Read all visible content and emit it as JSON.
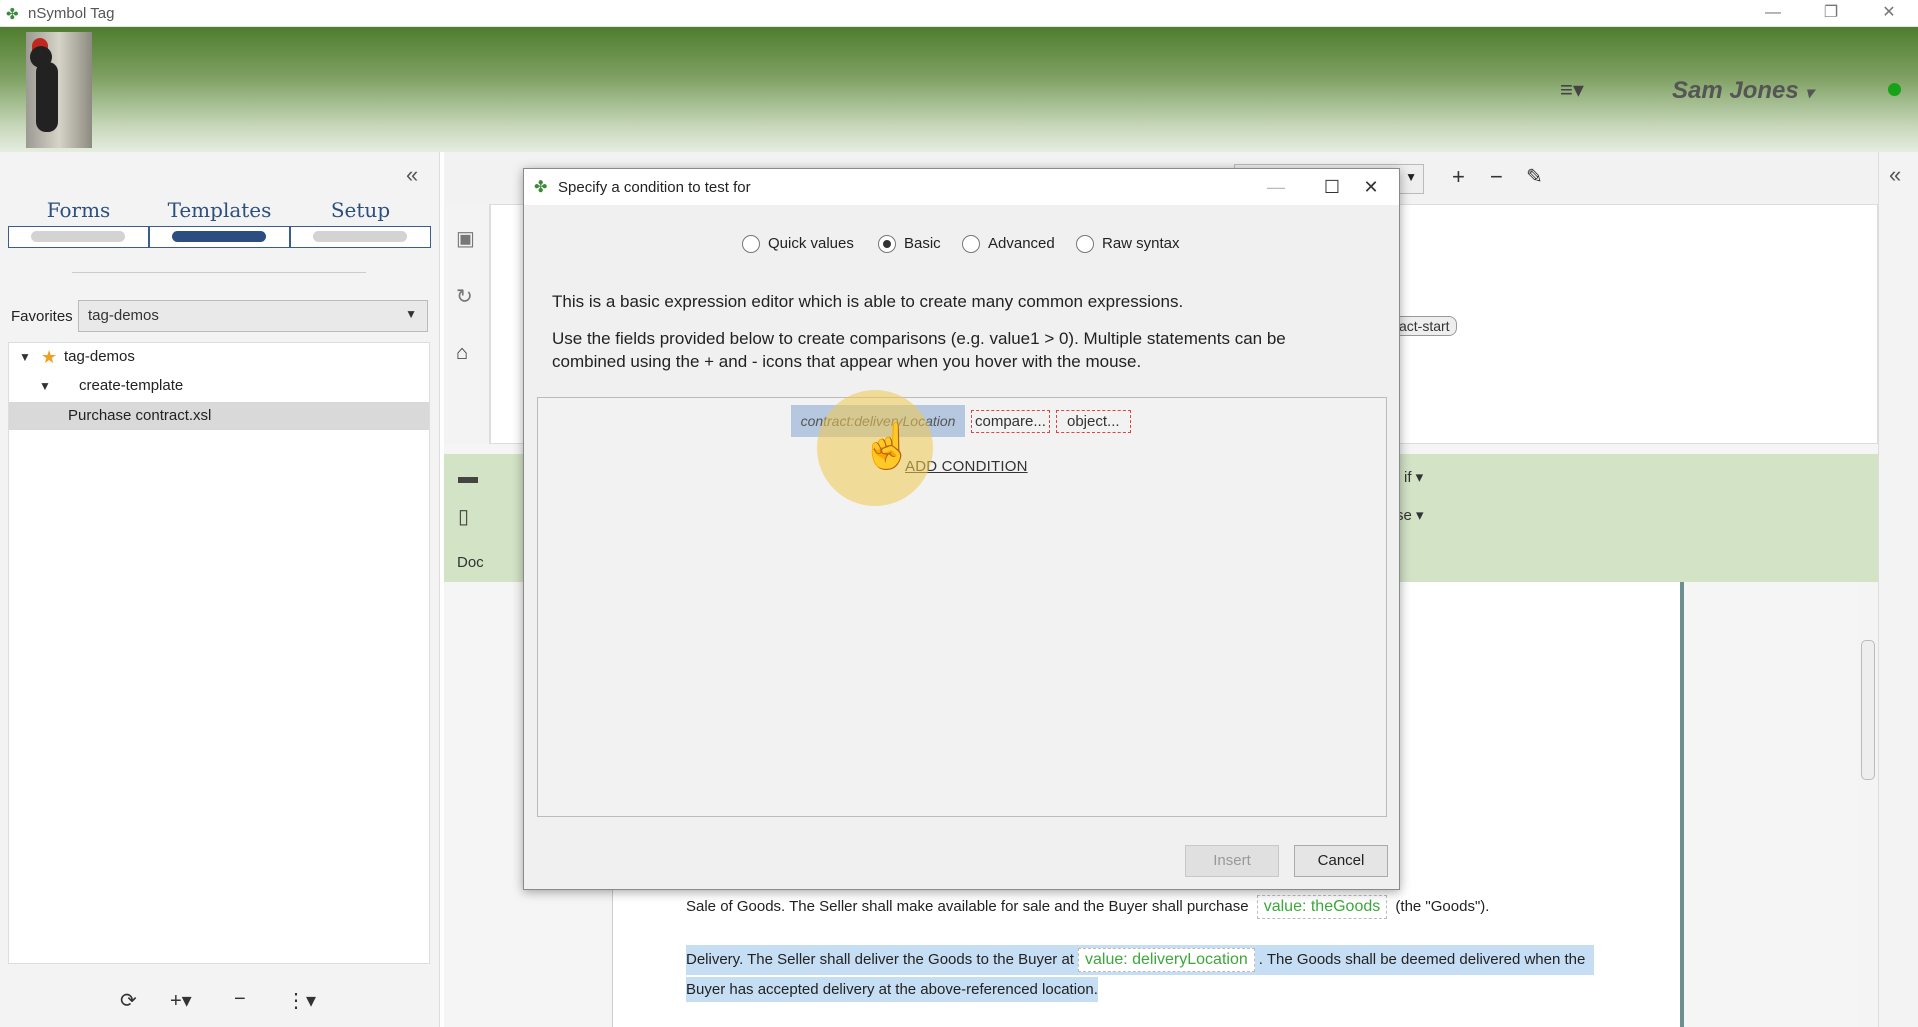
{
  "window": {
    "title": "nSymbol Tag",
    "logo_glyph": "✤"
  },
  "header": {
    "user": "Sam Jones",
    "user_caret": "▾",
    "menu_glyph": "≡▾",
    "status_color": "#17a317"
  },
  "left": {
    "collapse_glyph": "«",
    "tabs": [
      "Forms",
      "Templates",
      "Setup"
    ],
    "active_tab": "Templates",
    "favorites_label": "Favorites",
    "favorites_value": "tag-demos",
    "tree": [
      {
        "label": "tag-demos",
        "level": 0,
        "starred": true
      },
      {
        "label": "create-template",
        "level": 1
      },
      {
        "label": "Purchase contract.xsl",
        "level": 2,
        "selected": true
      }
    ],
    "bottom_buttons": [
      "⟳",
      "+▾",
      "−",
      "⋮▾"
    ]
  },
  "main": {
    "chip_start": "act-start",
    "doc_label": "Doc",
    "if_label": "if",
    "se_label": "se",
    "toolbar_icons": [
      "+",
      "−",
      "✎"
    ],
    "paragraphs": {
      "sale_prefix": "Sale of Goods. The Seller shall make available for sale and the Buyer shall purchase",
      "sale_chip": "value: theGoods",
      "sale_suffix": "(the \"Goods\").",
      "delivery_prefix": "Delivery. The Seller shall deliver the Goods to the Buyer at",
      "delivery_chip": "value: deliveryLocation",
      "delivery_suffix": ". The Goods shall be deemed delivered when the",
      "delivery_line2": "Buyer has accepted delivery at the above-referenced location."
    }
  },
  "dialog": {
    "title": "Specify a condition to test for",
    "radios": [
      {
        "label": "Quick values",
        "checked": false
      },
      {
        "label": "Basic",
        "checked": true
      },
      {
        "label": "Advanced",
        "checked": false
      },
      {
        "label": "Raw syntax",
        "checked": false
      }
    ],
    "desc1": "This is a basic expression editor which is able to create many common expressions.",
    "desc2_line1": "Use the fields provided below to create comparisons (e.g. value1 > 0). Multiple statements can be",
    "desc2_line2": "combined using the + and - icons that appear when you hover with the mouse.",
    "subject": "contract:deliveryLocation",
    "compare": "compare...",
    "object": "object...",
    "add_condition": "ADD CONDITION",
    "insert_label": "Insert",
    "cancel_label": "Cancel"
  }
}
